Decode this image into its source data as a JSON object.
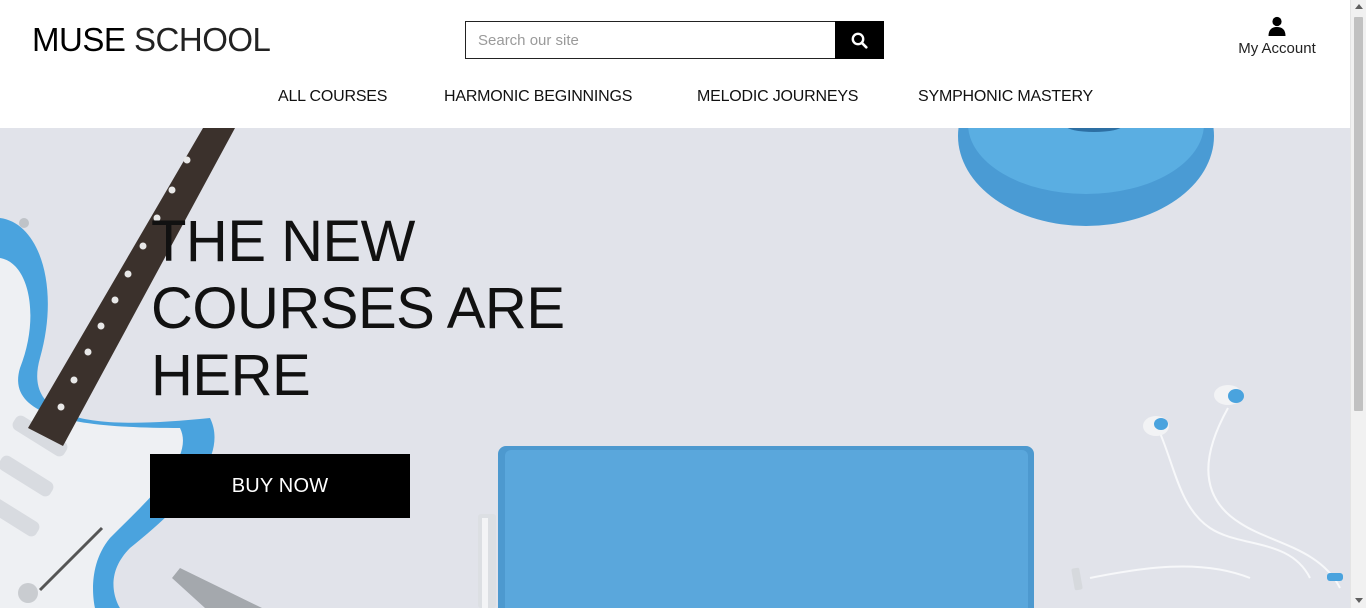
{
  "brand": {
    "name_bold": "MUSE",
    "name_light": "SCHOOL"
  },
  "search": {
    "placeholder": "Search our site",
    "value": "",
    "icon": "search-icon"
  },
  "account": {
    "label": "My Account",
    "icon": "user-icon"
  },
  "nav": {
    "items": [
      {
        "label": "ALL COURSES"
      },
      {
        "label": "HARMONIC BEGINNINGS"
      },
      {
        "label": "MELODIC JOURNEYS"
      },
      {
        "label": "SYMPHONIC MASTERY"
      }
    ]
  },
  "hero": {
    "title_lines": [
      "THE NEW",
      "COURSES ARE",
      "HERE"
    ],
    "cta_label": "BUY NOW",
    "background_color": "#e1e3ea",
    "accent_color": "#4fa3da"
  }
}
